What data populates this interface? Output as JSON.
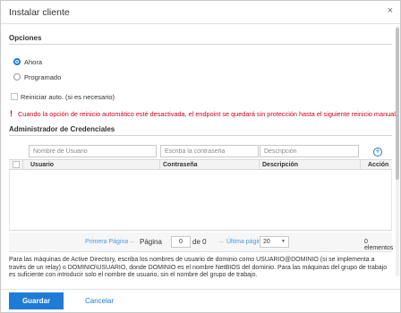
{
  "dialog": {
    "title": "Instalar cliente",
    "close_glyph": "×"
  },
  "options": {
    "heading": "Opciones",
    "radio_now": "Ahora",
    "radio_scheduled": "Programado",
    "selected": "Ahora",
    "auto_restart_label": "Reiniciar auto. (si es necesario)",
    "auto_restart_checked": false,
    "warning_icon": "!",
    "warning_text": "Cuando la opción de reinicio automático esté desactivada, el endpoint se quedará sin protección hasta el siguiente reinicio manual."
  },
  "credentials": {
    "heading": "Administrador de Credenciales",
    "user_placeholder": "Nombre de Usuario",
    "password_placeholder": "Escriba la contraseña",
    "description_placeholder": "Descripción",
    "add_glyph": "+",
    "columns": [
      "Usuario",
      "Contraseña",
      "Descripción",
      "Acción"
    ],
    "rows": []
  },
  "pager": {
    "first_label": "Primera Página",
    "prev_glyph": "←",
    "page_label": "Página",
    "page_value": "0",
    "of_label": "de 0",
    "next_glyph": "→",
    "last_label": "Última página",
    "page_size": "20",
    "count_text": "0 elementos"
  },
  "info_text": "Para las máquinas de Active Directory, escriba los nombres de usuario de dominio como USUARIO@DOMINIO (si se implementa a través de un relay) o DOMINIO\\USUARIO, donde DOMINIO es el nombre NetBIOS del dominio. Para las máquinas del grupo de trabajo es suficiente con introducir solo el nombre de usuario, sin el nombre del grupo de trabajo.",
  "footer": {
    "save_label": "Guardar",
    "cancel_label": "Cancelar"
  },
  "colors": {
    "accent": "#1e7bd6",
    "warning": "#d0021b",
    "link": "#4a9be2"
  }
}
